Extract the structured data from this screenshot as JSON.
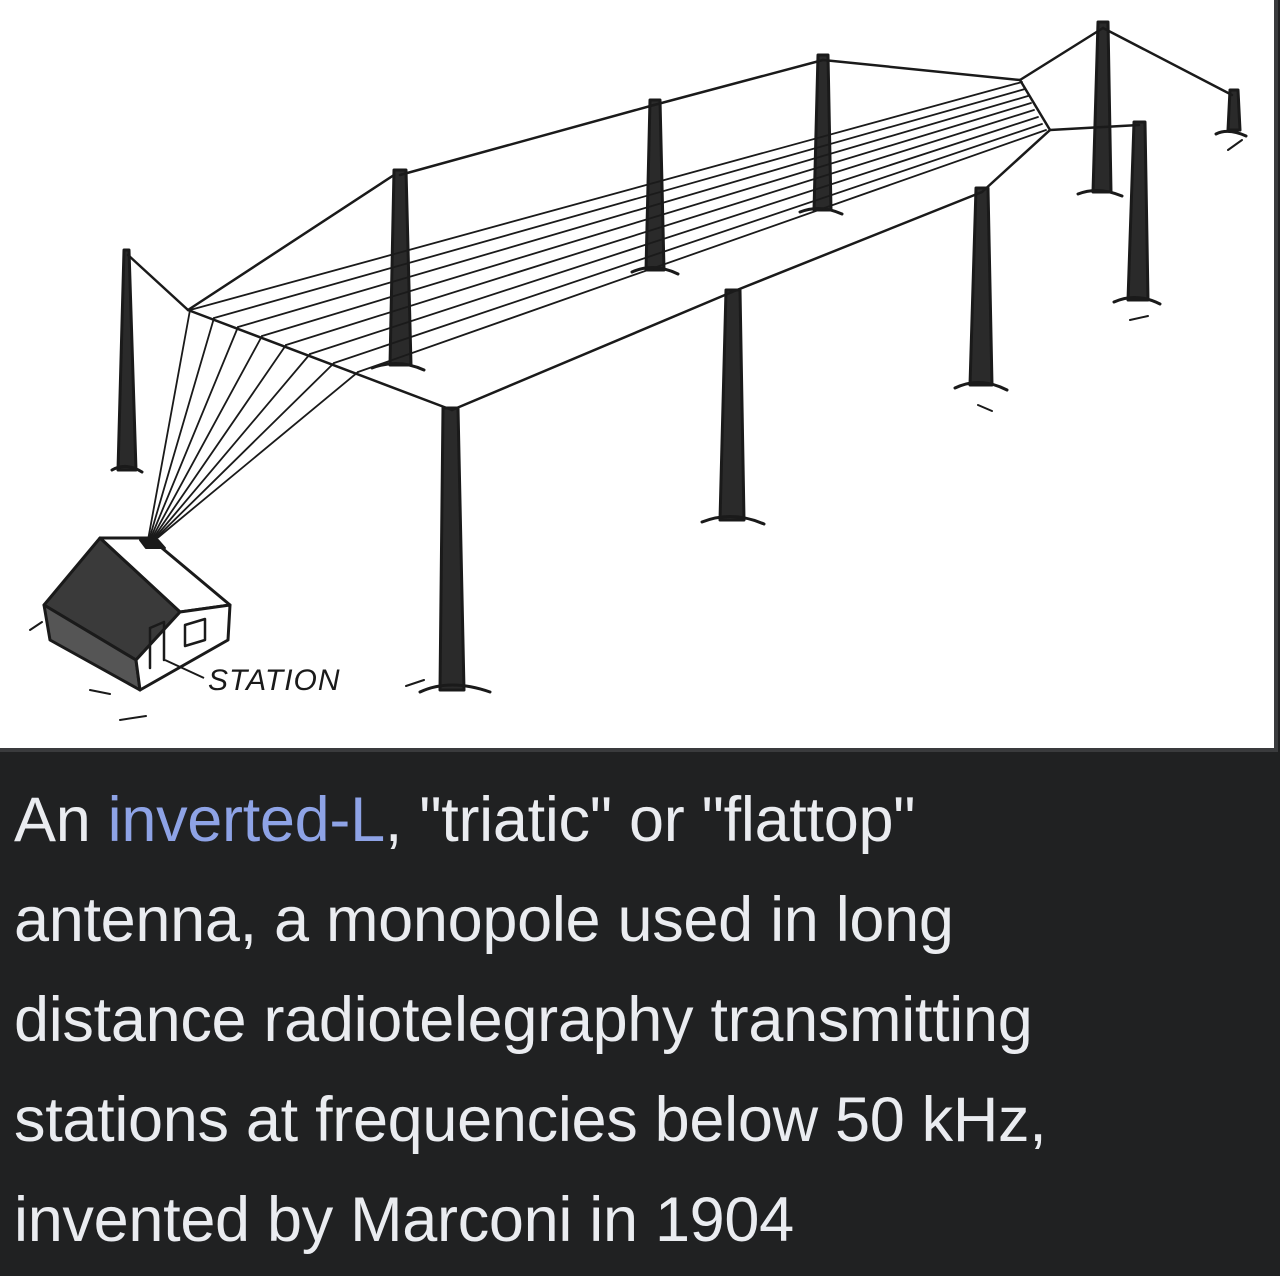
{
  "figure": {
    "illustration": {
      "label": "STATION"
    },
    "caption": {
      "prefix": "An ",
      "link_text": "inverted-L",
      "text_line1": ", \"triatic\" or \"flattop\"",
      "text_line2": "antenna, a monopole used in long",
      "text_line3": "distance radiotelegraphy transmitting",
      "text_line4": "stations at frequencies below 50 kHz,",
      "text_line5": "invented by Marconi in 1904"
    },
    "colors": {
      "background": "#202122",
      "caption_text": "#eaecf0",
      "link": "#8ea3e6",
      "image_background": "#ffffff",
      "ink": "#1a1a1a"
    }
  }
}
